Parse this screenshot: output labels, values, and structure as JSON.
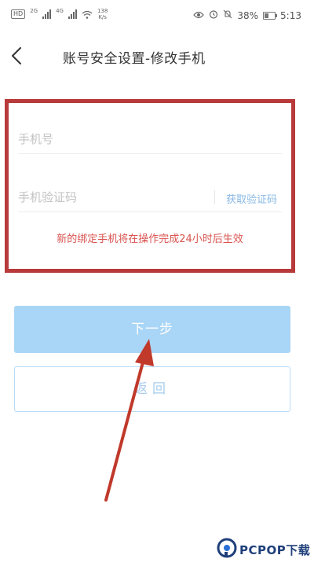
{
  "status_bar": {
    "sim_label": "HD",
    "net_tag_1": "2G",
    "net_tag_2": "4G",
    "speed_value": "138",
    "speed_unit": "K/s",
    "battery": "38%",
    "battery_level": 0.38,
    "time": "5:13"
  },
  "header": {
    "back_icon": "chevron-left-icon",
    "title": "账号安全设置-修改手机"
  },
  "form": {
    "phone_placeholder": "手机号",
    "phone_value": "",
    "code_placeholder": "手机验证码",
    "code_value": "",
    "get_code_label": "获取验证码",
    "notice": "新的绑定手机将在操作完成24小时后生效"
  },
  "buttons": {
    "next_label": "下一步",
    "back_label": "返回"
  },
  "colors": {
    "highlight_box": "#b83a3a",
    "primary_button": "#a9d5f6",
    "link": "#88b9e6",
    "notice": "#d9534f",
    "arrow": "#c0392b"
  },
  "watermark": {
    "text": "PCPOP下载"
  }
}
